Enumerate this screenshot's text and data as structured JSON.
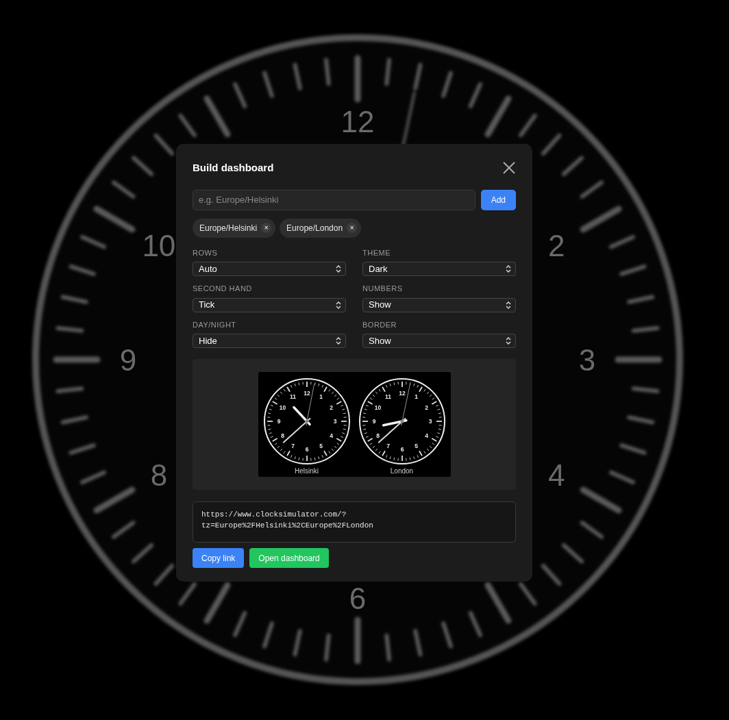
{
  "backdrop": {
    "numerals": [
      {
        "text": "12",
        "kind": "top"
      },
      {
        "text": "2",
        "kind": "upper_right"
      },
      {
        "text": "3",
        "kind": "right"
      },
      {
        "text": "4",
        "kind": "lower_right"
      },
      {
        "text": "6",
        "kind": "bottom"
      },
      {
        "text": "8",
        "kind": "lower_left"
      },
      {
        "text": "9",
        "kind": "left"
      },
      {
        "text": "10",
        "kind": "upper_left"
      }
    ]
  },
  "dialog": {
    "title": "Build dashboard",
    "search": {
      "placeholder": "e.g. Europe/Helsinki"
    },
    "add_button": "Add",
    "chips": [
      {
        "label": "Europe/Helsinki",
        "remove": "×"
      },
      {
        "label": "Europe/London",
        "remove": "×"
      }
    ],
    "settings": [
      {
        "label": "ROWS",
        "value": "Auto"
      },
      {
        "label": "THEME",
        "value": "Dark"
      },
      {
        "label": "SECOND HAND",
        "value": "Tick"
      },
      {
        "label": "NUMBERS",
        "value": "Show"
      },
      {
        "label": "DAY/NIGHT",
        "value": "Hide"
      },
      {
        "label": "BORDER",
        "value": "Show"
      }
    ],
    "preview": {
      "clocks": [
        {
          "label": "Helsinki",
          "numbers": [
            "12",
            "1",
            "2",
            "3",
            "4",
            "5",
            "6",
            "7",
            "8",
            "9",
            "10",
            "11"
          ]
        },
        {
          "label": "London",
          "numbers": [
            "12",
            "1",
            "2",
            "3",
            "4",
            "5",
            "6",
            "7",
            "8",
            "9",
            "10",
            "11"
          ]
        }
      ]
    },
    "link": "https://www.clocksimulator.com/?\ntz=Europe%2FHelsinki%2CEurope%2FLondon",
    "buttons": [
      {
        "kind": "primary",
        "label": "Copy link"
      },
      {
        "kind": "success",
        "label": "Open dashboard"
      }
    ]
  }
}
